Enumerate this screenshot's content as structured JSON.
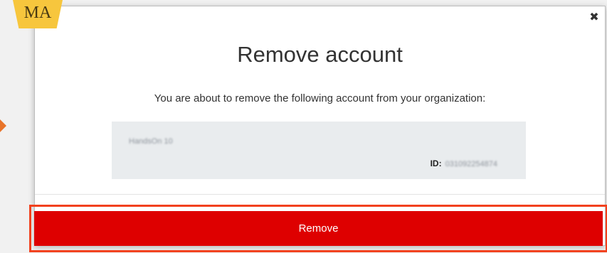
{
  "badge": {
    "text": "MA"
  },
  "modal": {
    "title": "Remove account",
    "description": "You are about to remove the following account from your organization:",
    "close_icon": "✖",
    "account": {
      "name": "HandsOn 10",
      "id_label": "ID:",
      "id_value": "031092254874"
    },
    "remove_label": "Remove"
  },
  "colors": {
    "remove_button": "#de0000",
    "highlight_border": "#f2411e",
    "badge": "#f7c63d"
  }
}
